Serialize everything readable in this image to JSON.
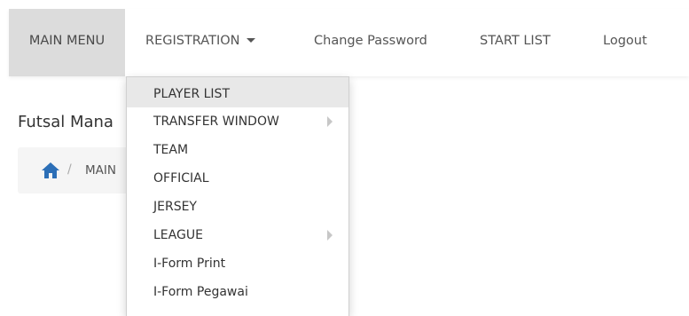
{
  "navbar": {
    "main_menu": "MAIN MENU",
    "registration": "REGISTRATION",
    "change_password": "Change Password",
    "start_list": "START LIST",
    "logout": "Logout"
  },
  "page": {
    "title": "Futsal Mana",
    "breadcrumb_separator": "/",
    "breadcrumb_item": "MAIN"
  },
  "dropdown": {
    "items": [
      {
        "label": "PLAYER LIST",
        "submenu": false,
        "highlighted": true
      },
      {
        "label": "TRANSFER WINDOW",
        "submenu": true
      },
      {
        "label": "TEAM",
        "submenu": false
      },
      {
        "label": "OFFICIAL",
        "submenu": false
      },
      {
        "label": "JERSEY",
        "submenu": false
      },
      {
        "label": "LEAGUE",
        "submenu": true
      },
      {
        "label": "I-Form Print",
        "submenu": false
      },
      {
        "label": "I-Form Pegawai",
        "submenu": false
      }
    ]
  },
  "icons": {
    "home": "home-icon",
    "caret": "caret-down-icon",
    "submenu": "chevron-right-icon"
  },
  "colors": {
    "active_nav_bg": "#dcdcdc",
    "highlight_bg": "#e8e8e8",
    "home_icon": "#2c6fb7",
    "breadcrumb_bg": "#f5f5f5"
  }
}
